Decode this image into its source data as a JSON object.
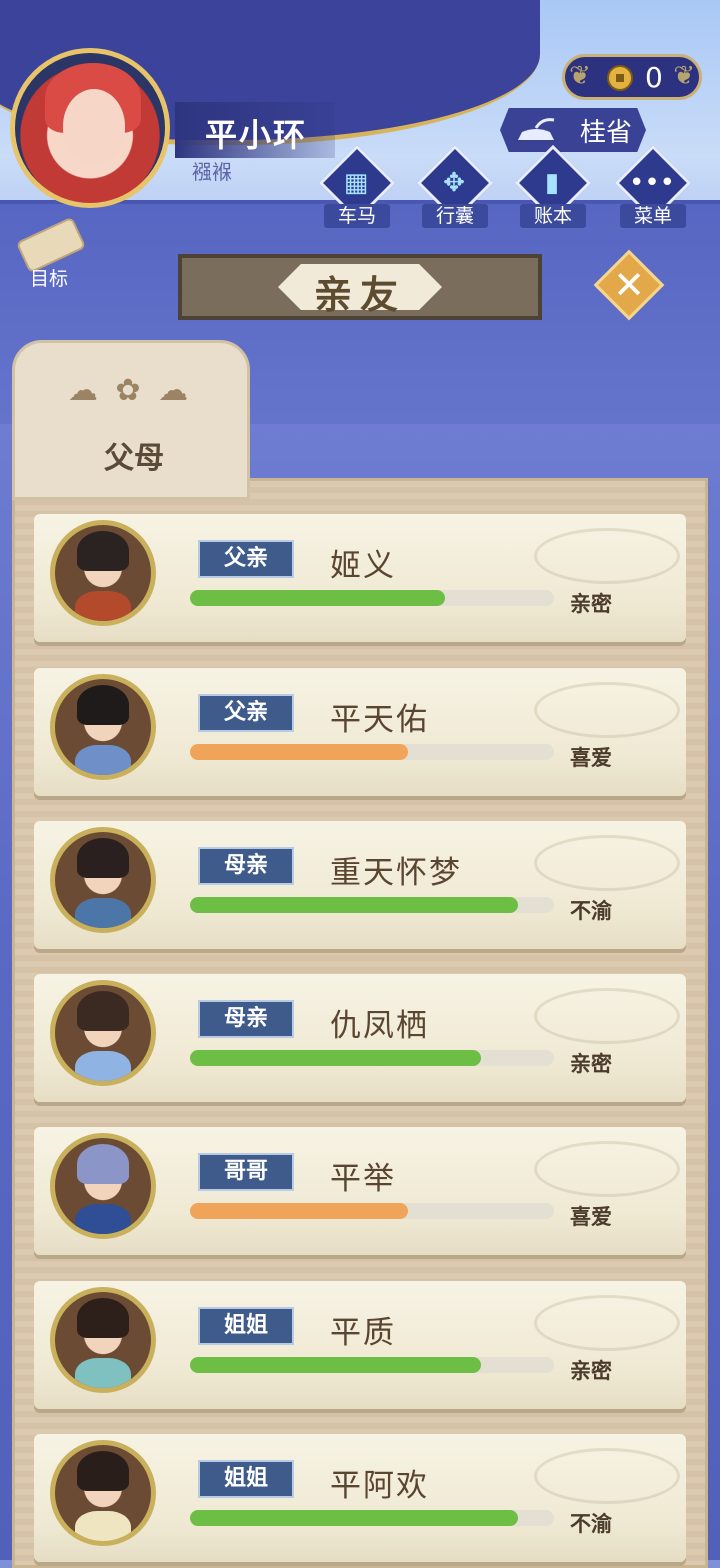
{
  "header": {
    "player_name": "平小环",
    "player_status": "襁褓",
    "coins": "0",
    "location": "桂省",
    "menu": [
      {
        "label": "车马",
        "icon": "carriage-icon"
      },
      {
        "label": "行囊",
        "icon": "bundle-icon"
      },
      {
        "label": "账本",
        "icon": "ledger-icon"
      },
      {
        "label": "菜单",
        "icon": "more-icon"
      }
    ],
    "goal_label": "目标"
  },
  "title": "亲友",
  "tab": {
    "label": "父母"
  },
  "members": [
    {
      "relation": "父亲",
      "name": "姬义",
      "affinity": "亲密",
      "level": 0.7,
      "color": "green",
      "hair": "#2b2321",
      "robe": "#b44a2c"
    },
    {
      "relation": "父亲",
      "name": "平天佑",
      "affinity": "喜爱",
      "level": 0.6,
      "color": "orange",
      "hair": "#1f1b1a",
      "robe": "#6f8fc8"
    },
    {
      "relation": "母亲",
      "name": "重天怀梦",
      "affinity": "不渝",
      "level": 0.9,
      "color": "green",
      "hair": "#2a2020",
      "robe": "#4d76a8"
    },
    {
      "relation": "母亲",
      "name": "仇凤栖",
      "affinity": "亲密",
      "level": 0.8,
      "color": "green",
      "hair": "#3b2a22",
      "robe": "#8fb4e3"
    },
    {
      "relation": "哥哥",
      "name": "平举",
      "affinity": "喜爱",
      "level": 0.6,
      "color": "orange",
      "hair": "#8c95c8",
      "robe": "#2f4e96"
    },
    {
      "relation": "姐姐",
      "name": "平质",
      "affinity": "亲密",
      "level": 0.8,
      "color": "green",
      "hair": "#2d1f1a",
      "robe": "#7fc0c0"
    },
    {
      "relation": "姐姐",
      "name": "平阿欢",
      "affinity": "不渝",
      "level": 0.9,
      "color": "green",
      "hair": "#2a1e1b",
      "robe": "#efe5c0"
    }
  ],
  "colors": {
    "green": "#6cbf44",
    "orange": "#f0a45a",
    "relation_bg": "#3f5b8b"
  }
}
